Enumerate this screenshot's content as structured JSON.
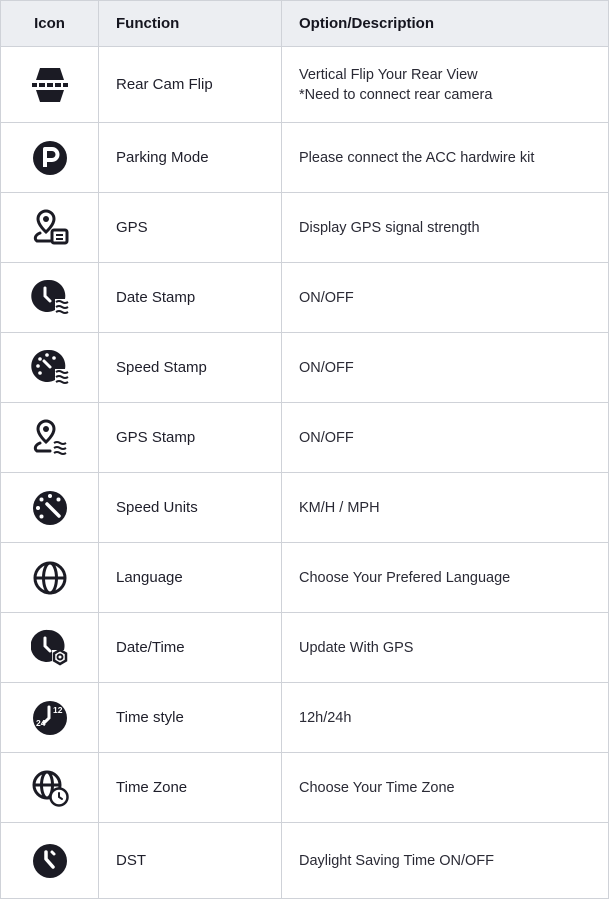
{
  "headers": {
    "icon": "Icon",
    "function": "Function",
    "description": "Option/Description"
  },
  "rows": [
    {
      "icon": "rear-camera-flip-icon",
      "function": "Rear Cam Flip",
      "description": [
        "Vertical Flip Your Rear View",
        "*Need to connect rear camera"
      ]
    },
    {
      "icon": "parking-icon",
      "function": "Parking Mode",
      "description": [
        "Please connect the ACC hardwire kit"
      ]
    },
    {
      "icon": "gps-pin-screen-icon",
      "function": "GPS",
      "description": [
        "Display GPS signal strength"
      ]
    },
    {
      "icon": "clock-waves-icon",
      "function": "Date Stamp",
      "description": [
        "ON/OFF"
      ]
    },
    {
      "icon": "speedometer-waves-icon",
      "function": "Speed Stamp",
      "description": [
        "ON/OFF"
      ]
    },
    {
      "icon": "gps-pin-waves-icon",
      "function": "GPS Stamp",
      "description": [
        "ON/OFF"
      ]
    },
    {
      "icon": "speedometer-icon",
      "function": "Speed Units",
      "description": [
        "KM/H / MPH"
      ]
    },
    {
      "icon": "globe-icon",
      "function": "Language",
      "description": [
        "Choose Your Prefered Language"
      ]
    },
    {
      "icon": "clock-gear-icon",
      "function": "Date/Time",
      "description": [
        "Update With GPS"
      ]
    },
    {
      "icon": "clock-24-12-icon",
      "function": "Time style",
      "description": [
        "12h/24h"
      ],
      "icon_text": [
        "24",
        "12"
      ]
    },
    {
      "icon": "globe-clock-icon",
      "function": "Time Zone",
      "description": [
        "Choose Your Time Zone"
      ]
    },
    {
      "icon": "dst-clock-icon",
      "function": "DST",
      "description": [
        "Daylight Saving Time ON/OFF"
      ]
    }
  ]
}
